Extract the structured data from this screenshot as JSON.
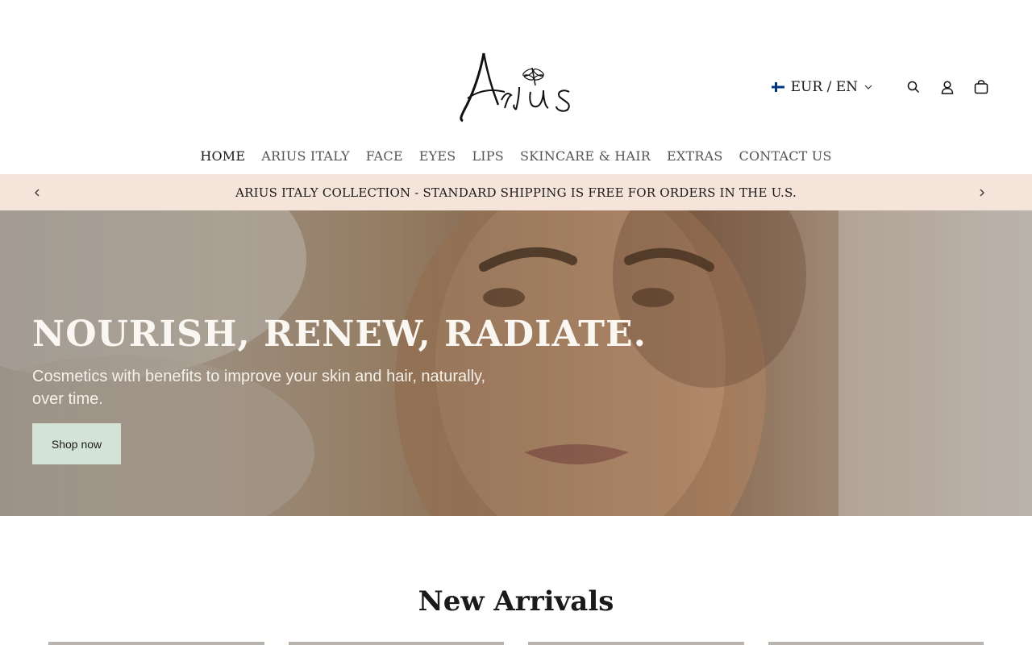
{
  "header": {
    "logo_alt": "Arius",
    "locale": "EUR / EN",
    "icons": [
      "search-icon",
      "account-icon",
      "cart-icon"
    ]
  },
  "nav": {
    "items": [
      "HOME",
      "ARIUS ITALY",
      "FACE",
      "EYES",
      "LIPS",
      "SKINCARE & HAIR",
      "EXTRAS",
      "CONTACT US"
    ],
    "active": "HOME"
  },
  "announcement": {
    "text": "ARIUS ITALY COLLECTION - STANDARD SHIPPING IS FREE FOR ORDERS IN THE U.S."
  },
  "hero": {
    "title": "NOURISH, RENEW, RADIATE.",
    "subtitle": "Cosmetics with benefits to improve your skin and hair, naturally, over time.",
    "button": "Shop now"
  },
  "new_arrivals": {
    "title": "New Arrivals"
  },
  "colors": {
    "announcement_bg": "#f5e4da",
    "button_bg": "#d3e3d5",
    "flag_blue": "#003580"
  }
}
